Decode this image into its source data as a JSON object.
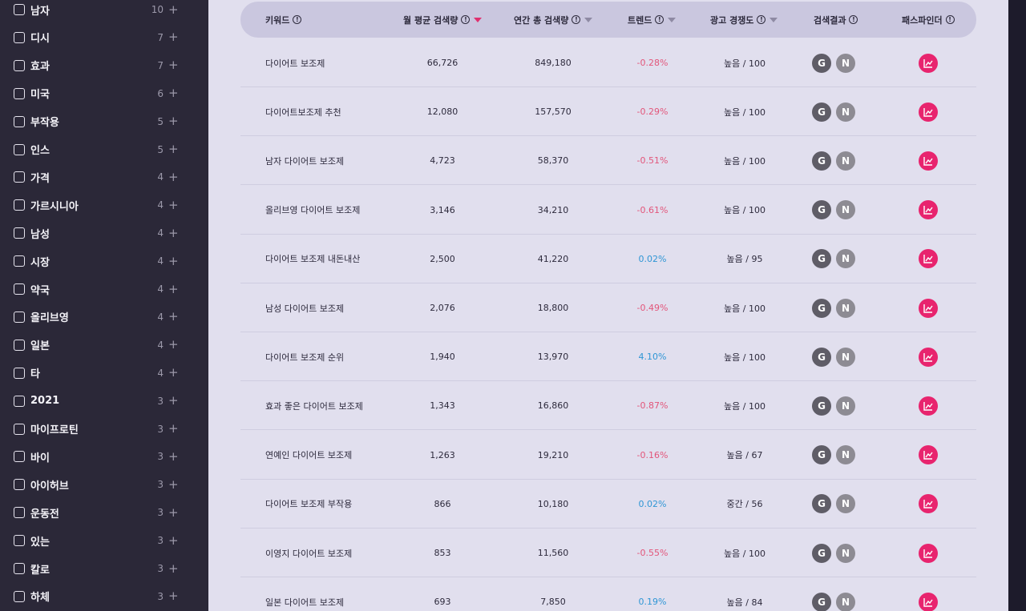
{
  "sidebar": {
    "items": [
      {
        "label": "남자",
        "count": "10"
      },
      {
        "label": "디시",
        "count": "7"
      },
      {
        "label": "효과",
        "count": "7"
      },
      {
        "label": "미국",
        "count": "6"
      },
      {
        "label": "부작용",
        "count": "5"
      },
      {
        "label": "인스",
        "count": "5"
      },
      {
        "label": "가격",
        "count": "4"
      },
      {
        "label": "가르시니아",
        "count": "4"
      },
      {
        "label": "남성",
        "count": "4"
      },
      {
        "label": "시장",
        "count": "4"
      },
      {
        "label": "약국",
        "count": "4"
      },
      {
        "label": "올리브영",
        "count": "4"
      },
      {
        "label": "일본",
        "count": "4"
      },
      {
        "label": "타",
        "count": "4"
      },
      {
        "label": "2021",
        "count": "3"
      },
      {
        "label": "마이프로틴",
        "count": "3"
      },
      {
        "label": "바이",
        "count": "3"
      },
      {
        "label": "아이허브",
        "count": "3"
      },
      {
        "label": "운동전",
        "count": "3"
      },
      {
        "label": "있는",
        "count": "3"
      },
      {
        "label": "칼로",
        "count": "3"
      },
      {
        "label": "하체",
        "count": "3"
      }
    ],
    "plus_symbol": "+"
  },
  "table": {
    "headers": {
      "keyword": "키워드",
      "monthly": "월 평균 검색량",
      "yearly": "연간 총 검색량",
      "trend": "트렌드",
      "competition": "광고 경쟁도",
      "results": "검색결과",
      "pathfinder": "패스파인더"
    },
    "info_symbol": "!",
    "google_letter": "G",
    "naver_letter": "N",
    "rows": [
      {
        "keyword": "다이어트 보조제",
        "monthly": "66,726",
        "yearly": "849,180",
        "trend": "-0.28%",
        "trend_dir": "neg",
        "competition": "높음 / 100"
      },
      {
        "keyword": "다이어트보조제 추천",
        "monthly": "12,080",
        "yearly": "157,570",
        "trend": "-0.29%",
        "trend_dir": "neg",
        "competition": "높음 / 100"
      },
      {
        "keyword": "남자 다이어트 보조제",
        "monthly": "4,723",
        "yearly": "58,370",
        "trend": "-0.51%",
        "trend_dir": "neg",
        "competition": "높음 / 100"
      },
      {
        "keyword": "올리브영 다이어트 보조제",
        "monthly": "3,146",
        "yearly": "34,210",
        "trend": "-0.61%",
        "trend_dir": "neg",
        "competition": "높음 / 100"
      },
      {
        "keyword": "다이어트 보조제 내돈내산",
        "monthly": "2,500",
        "yearly": "41,220",
        "trend": "0.02%",
        "trend_dir": "pos",
        "competition": "높음 / 95"
      },
      {
        "keyword": "남성 다이어트 보조제",
        "monthly": "2,076",
        "yearly": "18,800",
        "trend": "-0.49%",
        "trend_dir": "neg",
        "competition": "높음 / 100"
      },
      {
        "keyword": "다이어트 보조제 순위",
        "monthly": "1,940",
        "yearly": "13,970",
        "trend": "4.10%",
        "trend_dir": "pos",
        "competition": "높음 / 100"
      },
      {
        "keyword": "효과 좋은 다이어트 보조제",
        "monthly": "1,343",
        "yearly": "16,860",
        "trend": "-0.87%",
        "trend_dir": "neg",
        "competition": "높음 / 100"
      },
      {
        "keyword": "연예인 다이어트 보조제",
        "monthly": "1,263",
        "yearly": "19,210",
        "trend": "-0.16%",
        "trend_dir": "neg",
        "competition": "높음 / 67"
      },
      {
        "keyword": "다이어트 보조제 부작용",
        "monthly": "866",
        "yearly": "10,180",
        "trend": "0.02%",
        "trend_dir": "pos",
        "competition": "중간 / 56"
      },
      {
        "keyword": "이영지 다이어트 보조제",
        "monthly": "853",
        "yearly": "11,560",
        "trend": "-0.55%",
        "trend_dir": "neg",
        "competition": "높음 / 100"
      },
      {
        "keyword": "일본 다이어트 보조제",
        "monthly": "693",
        "yearly": "7,850",
        "trend": "0.19%",
        "trend_dir": "pos",
        "competition": "높음 / 84"
      }
    ]
  }
}
